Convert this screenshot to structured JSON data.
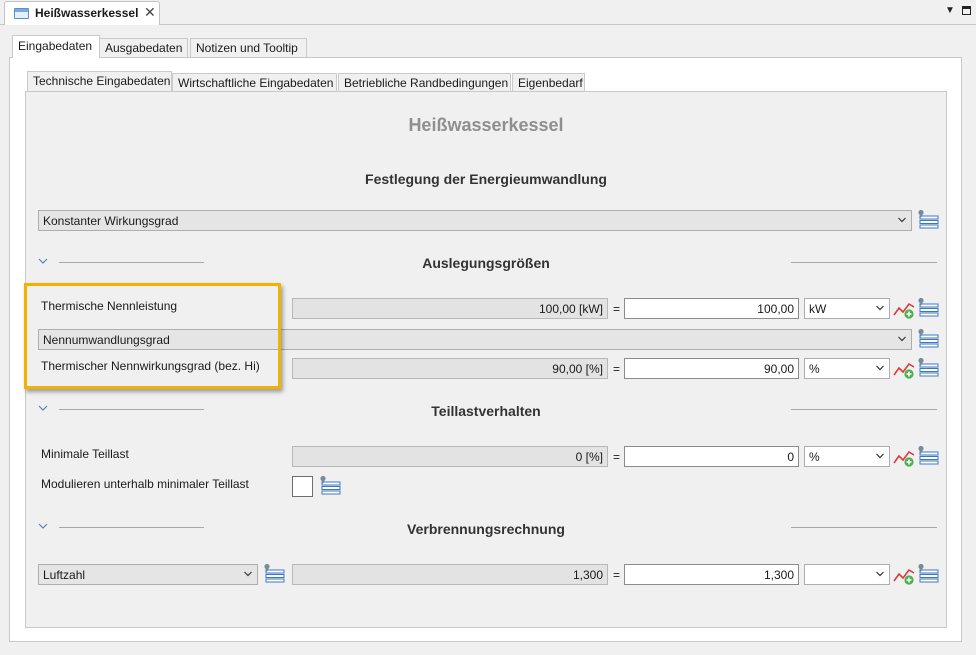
{
  "editor_tab": {
    "title": "Heißwasserkessel"
  },
  "outer_tabs": [
    {
      "label": "Eingabedaten",
      "active": true
    },
    {
      "label": "Ausgabedaten",
      "active": false
    },
    {
      "label": "Notizen und Tooltip",
      "active": false
    }
  ],
  "inner_tabs": [
    {
      "label": "Technische Eingabedaten",
      "active": true
    },
    {
      "label": "Wirtschaftliche Eingabedaten",
      "active": false
    },
    {
      "label": "Betriebliche Randbedingungen",
      "active": false
    },
    {
      "label": "Eigenbedarf",
      "active": false
    }
  ],
  "main_title": "Heißwasserkessel",
  "energy": {
    "heading": "Festlegung der Energieumwandlung",
    "mode": "Konstanter Wirkungsgrad"
  },
  "design": {
    "heading": "Auslegungsgrößen",
    "thermal_power": {
      "label": "Thermische Nennleistung",
      "display": "100,00 [kW]",
      "value": "100,00",
      "unit": "kW"
    },
    "conversion_mode": "Nennumwandlungsgrad",
    "efficiency": {
      "label": "Thermischer Nennwirkungsgrad (bez. Hi)",
      "display": "90,00 [%]",
      "value": "90,00",
      "unit": "%"
    }
  },
  "partload": {
    "heading": "Teillastverhalten",
    "min_partload": {
      "label": "Minimale Teillast",
      "display": "0 [%]",
      "value": "0",
      "unit": "%"
    },
    "modulate": {
      "label": "Modulieren unterhalb minimaler Teillast",
      "checked": false
    }
  },
  "combustion": {
    "heading": "Verbrennungsrechnung",
    "air_ratio": {
      "label": "Luftzahl",
      "display": "1,300",
      "value": "1,300",
      "unit": ""
    }
  },
  "symbols": {
    "equals": "=",
    "close": "✕",
    "view_menu": "▼"
  },
  "colors": {
    "highlight": "#f0b400",
    "title_gray": "#8f8f8f",
    "chart_red": "#d83a3a",
    "plus_green": "#4caf50",
    "list_blue": "#3b78c4"
  }
}
